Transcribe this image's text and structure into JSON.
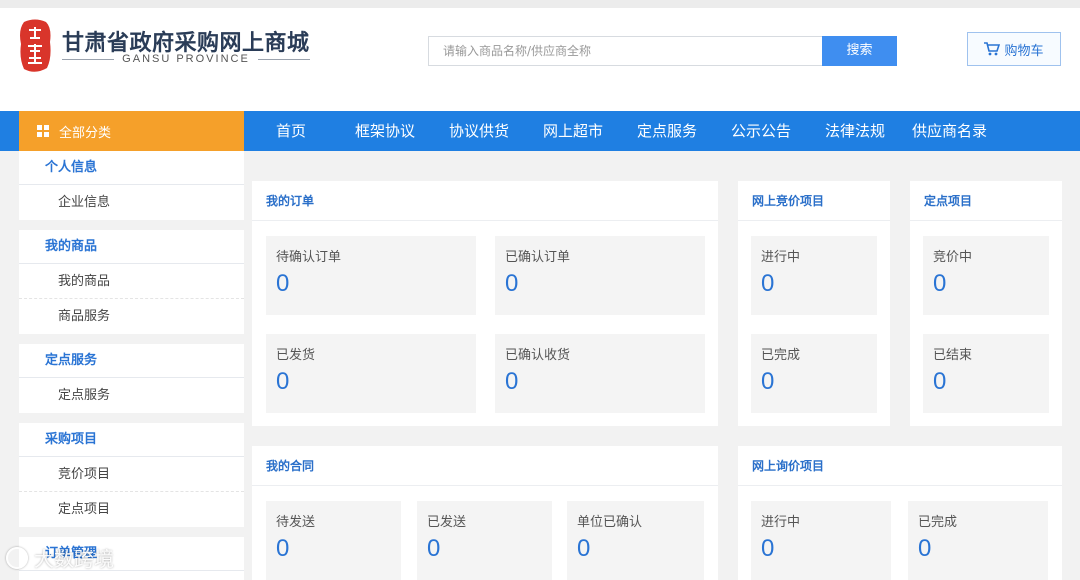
{
  "header": {
    "logo_cn": "甘肃省政府采购网上商城",
    "logo_en": "GANSU PROVINCE",
    "seal_color": "#d9352b",
    "search": {
      "placeholder": "请输入商品名称/供应商全称",
      "button": "搜索"
    },
    "cart": {
      "label": "购物车",
      "icon": "cart-icon"
    }
  },
  "nav": {
    "all_categories": "全部分类",
    "items": [
      "首页",
      "框架协议",
      "协议供货",
      "网上超市",
      "定点服务",
      "公示公告",
      "法律法规",
      "供应商名录"
    ],
    "accent": "#1f7fe2",
    "category_accent": "#f5a02a"
  },
  "sidebar": {
    "groups": [
      {
        "title": "个人信息",
        "items": [
          "企业信息"
        ]
      },
      {
        "title": "我的商品",
        "items": [
          "我的商品",
          "商品服务"
        ]
      },
      {
        "title": "定点服务",
        "items": [
          "定点服务"
        ]
      },
      {
        "title": "采购项目",
        "items": [
          "竞价项目",
          "定点项目"
        ]
      },
      {
        "title": "订单管理",
        "items": []
      }
    ]
  },
  "panels": {
    "orders": {
      "title": "我的订单",
      "stats": [
        {
          "label": "待确认订单",
          "value": "0"
        },
        {
          "label": "已确认订单",
          "value": "0"
        },
        {
          "label": "已发货",
          "value": "0"
        },
        {
          "label": "已确认收货",
          "value": "0"
        }
      ]
    },
    "bidding": {
      "title": "网上竞价项目",
      "stats": [
        {
          "label": "进行中",
          "value": "0"
        },
        {
          "label": "已完成",
          "value": "0"
        }
      ]
    },
    "fixed": {
      "title": "定点项目",
      "stats": [
        {
          "label": "竞价中",
          "value": "0"
        },
        {
          "label": "已结束",
          "value": "0"
        }
      ]
    },
    "contracts": {
      "title": "我的合同",
      "stats": [
        {
          "label": "待发送",
          "value": "0"
        },
        {
          "label": "已发送",
          "value": "0"
        },
        {
          "label": "单位已确认",
          "value": "0"
        }
      ]
    },
    "inquiry": {
      "title": "网上询价项目",
      "stats": [
        {
          "label": "进行中",
          "value": "0"
        },
        {
          "label": "已完成",
          "value": "0"
        }
      ]
    }
  },
  "watermark": {
    "text": "大数跨境"
  }
}
